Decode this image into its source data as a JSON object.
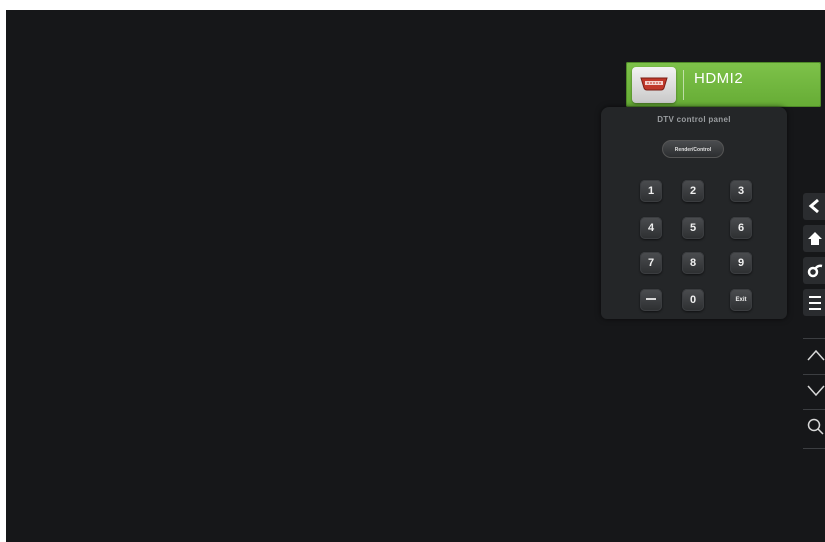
{
  "source": {
    "label": "HDMI2",
    "icon": "hdmi-port-icon",
    "color": "#6db63c"
  },
  "control_panel": {
    "title": "DTV control panel",
    "render_control_label": "Render/Control",
    "keys": [
      "1",
      "2",
      "3",
      "4",
      "5",
      "6",
      "7",
      "8",
      "9",
      "—",
      "0",
      "Exit"
    ]
  },
  "side_toolbar": {
    "buttons": [
      "back-icon",
      "home-icon",
      "link-icon",
      "menu-icon",
      "volume-up-icon",
      "volume-down-icon",
      "search-icon"
    ]
  },
  "colors": {
    "screen_background": "#161719",
    "panel_background": "#242628",
    "accent_green": "#6db63c"
  }
}
